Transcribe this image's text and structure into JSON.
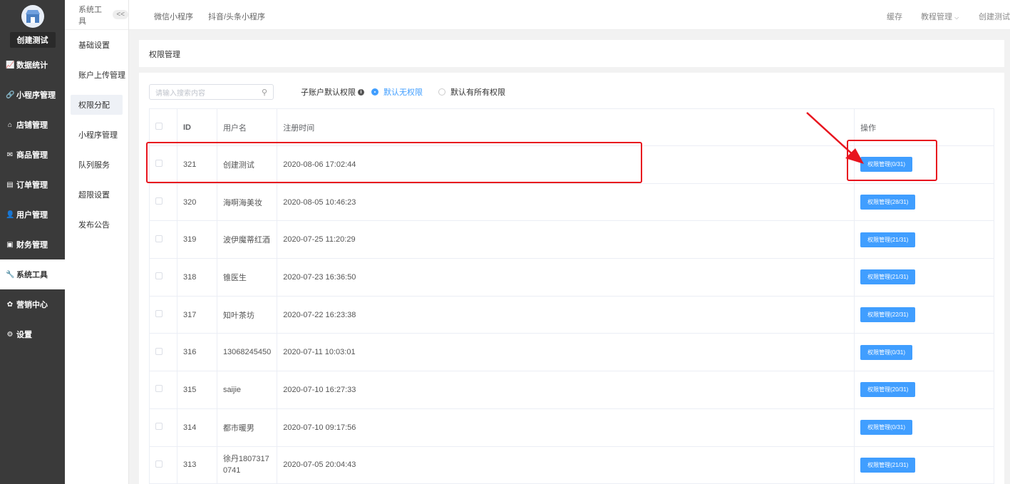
{
  "sidebar": {
    "shop_name": "创建测试",
    "items": [
      {
        "label": "数据统计",
        "icon": "chart-icon"
      },
      {
        "label": "小程序管理",
        "icon": "link-icon"
      },
      {
        "label": "店铺管理",
        "icon": "store-icon"
      },
      {
        "label": "商品管理",
        "icon": "mail-icon"
      },
      {
        "label": "订单管理",
        "icon": "list-icon"
      },
      {
        "label": "用户管理",
        "icon": "user-icon"
      },
      {
        "label": "财务管理",
        "icon": "wallet-icon"
      },
      {
        "label": "系统工具",
        "icon": "wrench-icon"
      },
      {
        "label": "营销中心",
        "icon": "palette-icon"
      },
      {
        "label": "设置",
        "icon": "gear-icon"
      }
    ]
  },
  "submenu": {
    "title": "系统工具",
    "collapse": "<<",
    "items": [
      "基础设置",
      "账户上传管理",
      "权限分配",
      "小程序管理",
      "队列服务",
      "超限设置",
      "发布公告"
    ]
  },
  "topbar": {
    "tabs": [
      "微信小程序",
      "抖音/头条小程序"
    ],
    "cache": "缓存",
    "tutorial": "教程管理",
    "user": "创建测试"
  },
  "page": {
    "title": "权限管理",
    "search_placeholder": "请输入搜索内容",
    "default_perm_label": "子账户默认权限",
    "radio_none": "默认无权限",
    "radio_all": "默认有所有权限"
  },
  "table": {
    "headers": {
      "id": "ID",
      "username": "用户名",
      "reg_time": "注册时间",
      "ops": "操作"
    },
    "rows": [
      {
        "id": "321",
        "username": "创建测试",
        "reg_time": "2020-08-06 17:02:44",
        "op": "权限管理(0/31)"
      },
      {
        "id": "320",
        "username": "海啊海美妆",
        "reg_time": "2020-08-05 10:46:23",
        "op": "权限管理(28/31)"
      },
      {
        "id": "319",
        "username": "波伊魔蒂红酒",
        "reg_time": "2020-07-25 11:20:29",
        "op": "权限管理(21/31)"
      },
      {
        "id": "318",
        "username": "锥医生",
        "reg_time": "2020-07-23 16:36:50",
        "op": "权限管理(21/31)"
      },
      {
        "id": "317",
        "username": "知叶茶坊",
        "reg_time": "2020-07-22 16:23:38",
        "op": "权限管理(22/31)"
      },
      {
        "id": "316",
        "username": "13068245450",
        "reg_time": "2020-07-11 10:03:01",
        "op": "权限管理(0/31)"
      },
      {
        "id": "315",
        "username": "saijie",
        "reg_time": "2020-07-10 16:27:33",
        "op": "权限管理(20/31)"
      },
      {
        "id": "314",
        "username": "都市暖男",
        "reg_time": "2020-07-10 09:17:56",
        "op": "权限管理(0/31)"
      },
      {
        "id": "313",
        "username": "徐丹18073170741",
        "reg_time": "2020-07-05 20:04:43",
        "op": "权限管理(21/31)"
      }
    ]
  },
  "colors": {
    "accent": "#409eff",
    "sidebar_bg": "#3a3a3a",
    "highlight": "#e8141e"
  }
}
